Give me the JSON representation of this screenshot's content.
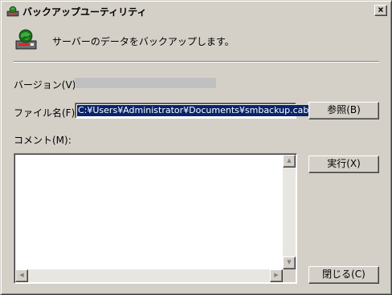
{
  "window": {
    "title": "バックアップユーティリティ",
    "close_glyph": "×"
  },
  "header": {
    "message": "サーバーのデータをバックアップします。"
  },
  "form": {
    "version_label": "バージョン(V):",
    "file_label": "ファイル名(F):",
    "file_value": "C:¥Users¥Administrator¥Documents¥smbackup.cab",
    "comment_label": "コメント(M):",
    "comment_value": ""
  },
  "buttons": {
    "browse": "参照(B)",
    "run": "実行(X)",
    "close": "閉じる(C)"
  },
  "scrollbar": {
    "up": "▲",
    "down": "▼",
    "left": "◀",
    "right": "▶"
  },
  "icons": {
    "title": "backup-drive-globe-icon",
    "header": "backup-drive-globe-icon"
  },
  "colors": {
    "face": "#d4d0c8",
    "selection": "#0a246a"
  }
}
